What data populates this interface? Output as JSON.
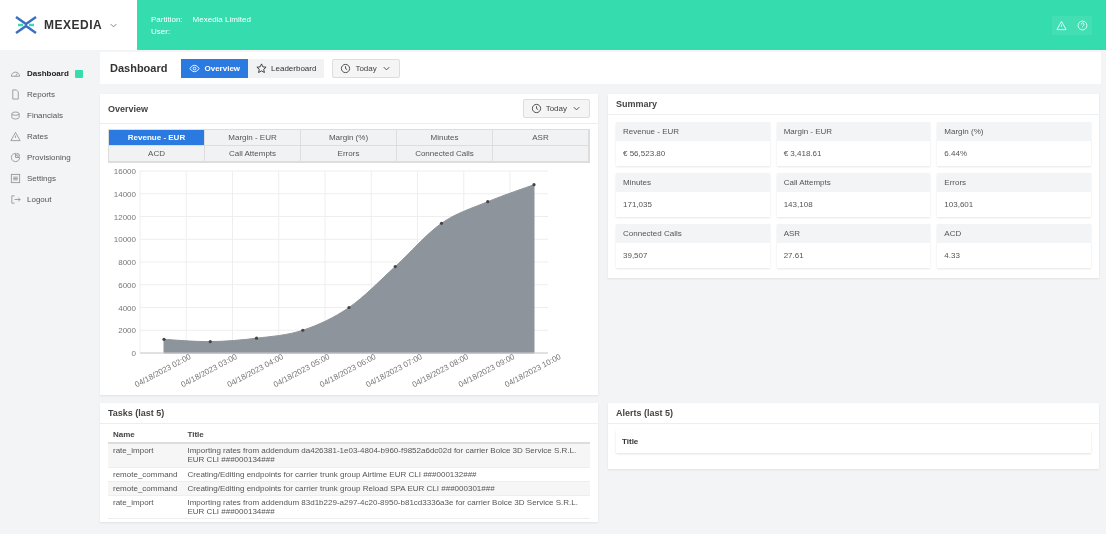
{
  "header": {
    "brand": "MEXEDIA",
    "partition_label": "Partition:",
    "partition_value": "Mexedia Limited",
    "user_label": "User:"
  },
  "sidebar": {
    "items": [
      {
        "label": "Dashboard",
        "selected": true,
        "badge": true
      },
      {
        "label": "Reports",
        "selected": false,
        "badge": false
      },
      {
        "label": "Financials",
        "selected": false,
        "badge": false
      },
      {
        "label": "Rates",
        "selected": false,
        "badge": false
      },
      {
        "label": "Provisioning",
        "selected": false,
        "badge": false
      },
      {
        "label": "Settings",
        "selected": false,
        "badge": false
      },
      {
        "label": "Logout",
        "selected": false,
        "badge": false
      }
    ]
  },
  "page": {
    "title": "Dashboard",
    "tabs": [
      {
        "label": "Overview",
        "selected": true
      },
      {
        "label": "Leaderboard",
        "selected": false
      }
    ],
    "period": "Today"
  },
  "overview": {
    "title": "Overview",
    "period": "Today",
    "metrics": [
      {
        "label": "Revenue - EUR",
        "selected": true
      },
      {
        "label": "Margin - EUR",
        "selected": false
      },
      {
        "label": "Margin (%)",
        "selected": false
      },
      {
        "label": "Minutes",
        "selected": false
      },
      {
        "label": "ASR",
        "selected": false
      },
      {
        "label": "ACD",
        "selected": false
      },
      {
        "label": "Call Attempts",
        "selected": false
      },
      {
        "label": "Errors",
        "selected": false
      },
      {
        "label": "Connected Calls",
        "selected": false
      }
    ],
    "chart_data": {
      "type": "area",
      "grid": true,
      "categories": [
        "04/18/2023 02:00",
        "04/18/2023 03:00",
        "04/18/2023 04:00",
        "04/18/2023 05:00",
        "04/18/2023 06:00",
        "04/18/2023 07:00",
        "04/18/2023 08:00",
        "04/18/2023 09:00",
        "04/18/2023 10:00"
      ],
      "series": [
        {
          "color": "#8e949c",
          "values": [
            1200,
            1000,
            1300,
            2000,
            4000,
            7600,
            11400,
            13300,
            14800
          ]
        }
      ],
      "ylim": [
        0,
        16000
      ],
      "yticks": [
        0,
        2000,
        4000,
        6000,
        8000,
        10000,
        12000,
        14000,
        16000
      ]
    }
  },
  "summary": {
    "title": "Summary",
    "cards": [
      {
        "label": "Revenue - EUR",
        "value": "€ 56,523.80"
      },
      {
        "label": "Margin - EUR",
        "value": "€ 3,418.61"
      },
      {
        "label": "Margin (%)",
        "value": "6.44%"
      },
      {
        "label": "Minutes",
        "value": "171,035"
      },
      {
        "label": "Call Attempts",
        "value": "143,108"
      },
      {
        "label": "Errors",
        "value": "103,601"
      },
      {
        "label": "Connected Calls",
        "value": "39,507"
      },
      {
        "label": "ASR",
        "value": "27.61"
      },
      {
        "label": "ACD",
        "value": "4.33"
      }
    ]
  },
  "tasks": {
    "title": "Tasks (last 5)",
    "columns": [
      "Name",
      "Title"
    ],
    "rows": [
      [
        "rate_import",
        "Importing rates from addendum da426381-1e03-4804-b960-f9852a6dc02d for carrier Bolce 3D Service S.R.L. EUR CLI ###000134###"
      ],
      [
        "remote_command",
        "Creating/Editing endpoints for carrier trunk group Airtime EUR CLI ###000132###"
      ],
      [
        "remote_command",
        "Creating/Editing endpoints for carrier trunk group Reload SPA EUR CLI ###000301###"
      ],
      [
        "rate_import",
        "Importing rates from addendum 83d1b229-a297-4c20-8950-b81cd3336a3e for carrier Bolce 3D Service S.R.L. EUR CLI ###000134###"
      ]
    ]
  },
  "alerts": {
    "title": "Alerts (last 5)",
    "columns": [
      "Title"
    ]
  }
}
